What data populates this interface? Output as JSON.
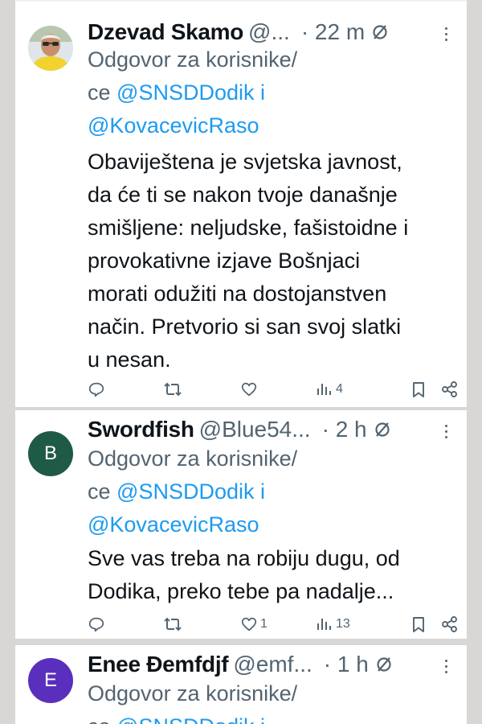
{
  "tweets": [
    {
      "name": "Dzevad Skamo",
      "handle": "@...",
      "time": "· 22 m",
      "avatar_letter": "",
      "reply_prefix": "Odgovor za korisnike/",
      "reply_prefix2": "ce ",
      "mention1": "@SNSDDodik",
      "conj": " i",
      "mention2": "@KovacevicRaso",
      "body_lines": [
        "Obaviještena je svjetska javnost,",
        "da će ti se nakon tvoje današnje",
        "smišljene: neljudske, fašistoidne i",
        "provokativne izjave Bošnjaci",
        "morati odužiti na dostojanstven",
        "način. Pretvorio si san svoj slatki",
        "u nesan."
      ],
      "likes": "",
      "views": "4"
    },
    {
      "name": "Swordfish",
      "handle": "@Blue54...",
      "time": "· 2 h",
      "avatar_letter": "B",
      "avatar_color": "#1f5a46",
      "reply_prefix": "Odgovor za korisnike/",
      "reply_prefix2": "ce ",
      "mention1": "@SNSDDodik",
      "conj": " i",
      "mention2": "@KovacevicRaso",
      "body_lines": [
        "Sve vas treba na robiju dugu, od",
        "Dodika, preko tebe pa nadalje..."
      ],
      "likes": "1",
      "views": "13"
    },
    {
      "name": "Enee Đemfdjf",
      "handle": "@emf...",
      "time": "· 1 h",
      "avatar_letter": "E",
      "avatar_color": "#5b2fbd",
      "reply_prefix": "Odgovor za korisnike/",
      "reply_prefix2": "ce ",
      "mention1": "@SNSDDodik",
      "conj": " i"
    }
  ],
  "icons": {
    "reply": "reply-icon",
    "retweet": "retweet-icon",
    "like": "heart-icon",
    "views": "views-icon",
    "bookmark": "bookmark-icon",
    "share": "share-icon",
    "mute": "muted-conversation-icon",
    "more": "more-options-icon"
  },
  "colors": {
    "link": "#1d9bf0",
    "secondary": "#536471",
    "text": "#0f1419",
    "background": "#d9d6d6"
  }
}
